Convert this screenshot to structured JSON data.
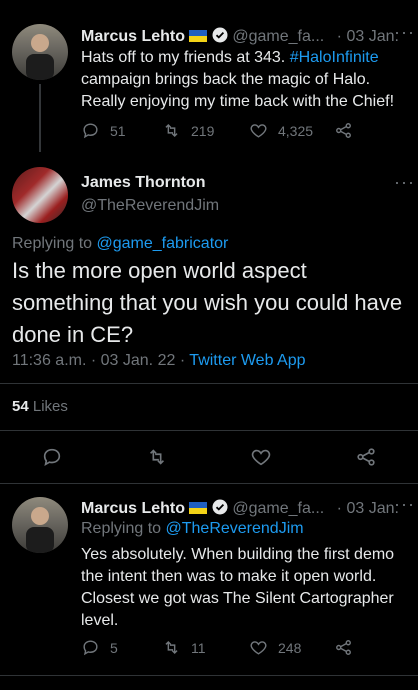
{
  "tweet1": {
    "name": "Marcus Lehto",
    "handle": "@game_fa...",
    "date": "· 03 Jan.",
    "text_before": "Hats off to my friends at 343. ",
    "hashtag": "#HaloInfinite",
    "text_after": " campaign brings back the magic of Halo. Really enjoying my time back with the Chief!",
    "replies": "51",
    "retweets": "219",
    "likes": "4,325"
  },
  "tweet2": {
    "name": "James Thornton",
    "handle": "@TheReverendJim",
    "replying_prefix": "Replying to ",
    "replying_handle": "@game_fabricator",
    "text": "Is the more open world aspect something that you wish you could have done in CE?",
    "time": "11:36 a.m.",
    "date": " · 03 Jan. 22 · ",
    "source": "Twitter Web App",
    "likes_count": "54",
    "likes_label": " Likes"
  },
  "tweet3": {
    "name": "Marcus Lehto",
    "handle": "@game_fa...",
    "date": "· 03 Jan.",
    "replying_prefix": "Replying to ",
    "replying_handle": "@TheReverendJim",
    "text": "Yes absolutely. When building the first demo the intent then was to make it open world. Closest we got was The Silent Cartographer level.",
    "replies": "5",
    "retweets": "11",
    "likes": "248"
  },
  "colors": {
    "accent": "#1d9bf0",
    "muted": "#71767b",
    "background": "#000000"
  }
}
